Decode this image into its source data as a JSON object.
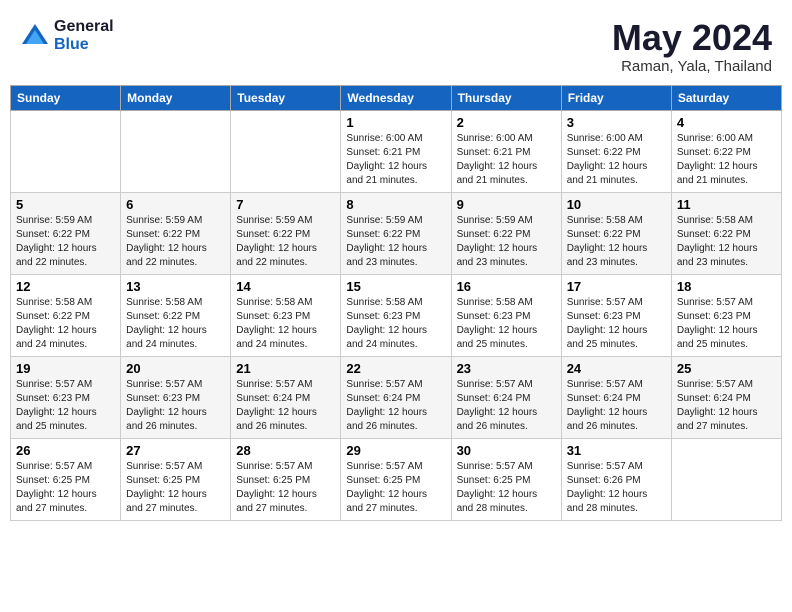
{
  "header": {
    "logo_general": "General",
    "logo_blue": "Blue",
    "month": "May 2024",
    "location": "Raman, Yala, Thailand"
  },
  "weekdays": [
    "Sunday",
    "Monday",
    "Tuesday",
    "Wednesday",
    "Thursday",
    "Friday",
    "Saturday"
  ],
  "weeks": [
    [
      {
        "day": "",
        "info": ""
      },
      {
        "day": "",
        "info": ""
      },
      {
        "day": "",
        "info": ""
      },
      {
        "day": "1",
        "info": "Sunrise: 6:00 AM\nSunset: 6:21 PM\nDaylight: 12 hours\nand 21 minutes."
      },
      {
        "day": "2",
        "info": "Sunrise: 6:00 AM\nSunset: 6:21 PM\nDaylight: 12 hours\nand 21 minutes."
      },
      {
        "day": "3",
        "info": "Sunrise: 6:00 AM\nSunset: 6:22 PM\nDaylight: 12 hours\nand 21 minutes."
      },
      {
        "day": "4",
        "info": "Sunrise: 6:00 AM\nSunset: 6:22 PM\nDaylight: 12 hours\nand 21 minutes."
      }
    ],
    [
      {
        "day": "5",
        "info": "Sunrise: 5:59 AM\nSunset: 6:22 PM\nDaylight: 12 hours\nand 22 minutes."
      },
      {
        "day": "6",
        "info": "Sunrise: 5:59 AM\nSunset: 6:22 PM\nDaylight: 12 hours\nand 22 minutes."
      },
      {
        "day": "7",
        "info": "Sunrise: 5:59 AM\nSunset: 6:22 PM\nDaylight: 12 hours\nand 22 minutes."
      },
      {
        "day": "8",
        "info": "Sunrise: 5:59 AM\nSunset: 6:22 PM\nDaylight: 12 hours\nand 23 minutes."
      },
      {
        "day": "9",
        "info": "Sunrise: 5:59 AM\nSunset: 6:22 PM\nDaylight: 12 hours\nand 23 minutes."
      },
      {
        "day": "10",
        "info": "Sunrise: 5:58 AM\nSunset: 6:22 PM\nDaylight: 12 hours\nand 23 minutes."
      },
      {
        "day": "11",
        "info": "Sunrise: 5:58 AM\nSunset: 6:22 PM\nDaylight: 12 hours\nand 23 minutes."
      }
    ],
    [
      {
        "day": "12",
        "info": "Sunrise: 5:58 AM\nSunset: 6:22 PM\nDaylight: 12 hours\nand 24 minutes."
      },
      {
        "day": "13",
        "info": "Sunrise: 5:58 AM\nSunset: 6:22 PM\nDaylight: 12 hours\nand 24 minutes."
      },
      {
        "day": "14",
        "info": "Sunrise: 5:58 AM\nSunset: 6:23 PM\nDaylight: 12 hours\nand 24 minutes."
      },
      {
        "day": "15",
        "info": "Sunrise: 5:58 AM\nSunset: 6:23 PM\nDaylight: 12 hours\nand 24 minutes."
      },
      {
        "day": "16",
        "info": "Sunrise: 5:58 AM\nSunset: 6:23 PM\nDaylight: 12 hours\nand 25 minutes."
      },
      {
        "day": "17",
        "info": "Sunrise: 5:57 AM\nSunset: 6:23 PM\nDaylight: 12 hours\nand 25 minutes."
      },
      {
        "day": "18",
        "info": "Sunrise: 5:57 AM\nSunset: 6:23 PM\nDaylight: 12 hours\nand 25 minutes."
      }
    ],
    [
      {
        "day": "19",
        "info": "Sunrise: 5:57 AM\nSunset: 6:23 PM\nDaylight: 12 hours\nand 25 minutes."
      },
      {
        "day": "20",
        "info": "Sunrise: 5:57 AM\nSunset: 6:23 PM\nDaylight: 12 hours\nand 26 minutes."
      },
      {
        "day": "21",
        "info": "Sunrise: 5:57 AM\nSunset: 6:24 PM\nDaylight: 12 hours\nand 26 minutes."
      },
      {
        "day": "22",
        "info": "Sunrise: 5:57 AM\nSunset: 6:24 PM\nDaylight: 12 hours\nand 26 minutes."
      },
      {
        "day": "23",
        "info": "Sunrise: 5:57 AM\nSunset: 6:24 PM\nDaylight: 12 hours\nand 26 minutes."
      },
      {
        "day": "24",
        "info": "Sunrise: 5:57 AM\nSunset: 6:24 PM\nDaylight: 12 hours\nand 26 minutes."
      },
      {
        "day": "25",
        "info": "Sunrise: 5:57 AM\nSunset: 6:24 PM\nDaylight: 12 hours\nand 27 minutes."
      }
    ],
    [
      {
        "day": "26",
        "info": "Sunrise: 5:57 AM\nSunset: 6:25 PM\nDaylight: 12 hours\nand 27 minutes."
      },
      {
        "day": "27",
        "info": "Sunrise: 5:57 AM\nSunset: 6:25 PM\nDaylight: 12 hours\nand 27 minutes."
      },
      {
        "day": "28",
        "info": "Sunrise: 5:57 AM\nSunset: 6:25 PM\nDaylight: 12 hours\nand 27 minutes."
      },
      {
        "day": "29",
        "info": "Sunrise: 5:57 AM\nSunset: 6:25 PM\nDaylight: 12 hours\nand 27 minutes."
      },
      {
        "day": "30",
        "info": "Sunrise: 5:57 AM\nSunset: 6:25 PM\nDaylight: 12 hours\nand 28 minutes."
      },
      {
        "day": "31",
        "info": "Sunrise: 5:57 AM\nSunset: 6:26 PM\nDaylight: 12 hours\nand 28 minutes."
      },
      {
        "day": "",
        "info": ""
      }
    ]
  ]
}
